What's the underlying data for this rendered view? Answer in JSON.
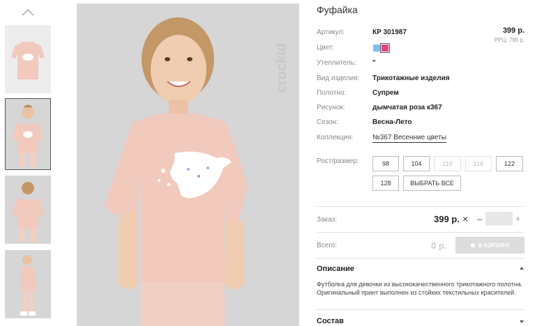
{
  "product": {
    "title": "Фуфайка",
    "price": "399 р.",
    "rrp": "РРЦ: 799 р."
  },
  "attributes": {
    "article": {
      "label": "Артикул:",
      "value": "КР 301987"
    },
    "color": {
      "label": "Цвет:",
      "swatches": [
        "#7ec3ee",
        "#e0457a"
      ],
      "selected": "#e0457a"
    },
    "insulation": {
      "label": "Утеплитель:",
      "value": "\""
    },
    "kind": {
      "label": "Вид изделия:",
      "value": "Трикотажные изделия"
    },
    "fabric": {
      "label": "Полотно:",
      "value": "Супрем"
    },
    "print": {
      "label": "Рисунок:",
      "value": "дымчатая роза к367"
    },
    "season": {
      "label": "Сезон:",
      "value": "Весна-Лето"
    },
    "collection": {
      "label": "Коллекция:",
      "value": "№367 Весенние цветы"
    }
  },
  "sizes": {
    "label": "Рост/размер:",
    "items": [
      {
        "label": "98",
        "available": true
      },
      {
        "label": "104",
        "available": true
      },
      {
        "label": "110",
        "available": false
      },
      {
        "label": "116",
        "available": false
      },
      {
        "label": "122",
        "available": true
      },
      {
        "label": "128",
        "available": true
      }
    ],
    "select_all": "ВЫБРАТЬ ВСЕ"
  },
  "order": {
    "label": "Заказ:",
    "price": "399 р.",
    "remove_icon": "×",
    "minus": "–",
    "quantity": "",
    "plus": "+"
  },
  "total": {
    "label": "Всего:",
    "value": "0 р.",
    "cart_button": "В КОРЗИНУ"
  },
  "sections": {
    "description_title": "Описание",
    "description_text": "Футболка для девочки из высококачественного трикотажного полотна. Оригинальный принт выполнен из стойких текстильных красителей.",
    "composition_title": "Состав"
  },
  "brand": {
    "logo_text": "crockid"
  },
  "colors": {
    "shirt": "#f1c9bd",
    "background": "#d6d6d6",
    "accent_pink": "#e0457a",
    "accent_blue": "#7ec3ee"
  },
  "icons": [
    "chevron-up-icon",
    "close-icon",
    "cart-icon",
    "chevron-up-small-icon"
  ]
}
